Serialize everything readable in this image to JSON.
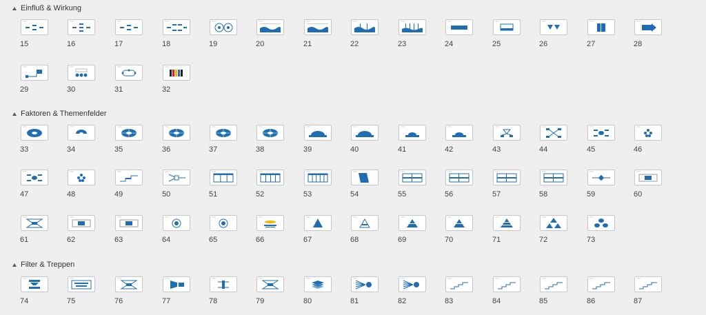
{
  "colors": {
    "accent": "#1f6eb5",
    "background": "#efefef",
    "thumb_border": "#c9c9c9"
  },
  "sections": [
    {
      "title": "Einfluß & Wirkung",
      "rows": [
        [
          {
            "number": "15",
            "icon": "cause-effect-diagram-icon",
            "variant": "flow3"
          },
          {
            "number": "16",
            "icon": "cause-effect-diagram-icon",
            "variant": "flow4"
          },
          {
            "number": "17",
            "icon": "cause-effect-diagram-icon",
            "variant": "flow3"
          },
          {
            "number": "18",
            "icon": "cause-effect-diagram-icon",
            "variant": "flow5"
          },
          {
            "number": "19",
            "icon": "radial-circles-icon",
            "variant": "rings"
          },
          {
            "number": "20",
            "icon": "wave-chart-icon",
            "variant": "wave"
          },
          {
            "number": "21",
            "icon": "wave-chart-icon",
            "variant": "wave2"
          },
          {
            "number": "22",
            "icon": "wave-columns-icon",
            "variant": "wave3"
          },
          {
            "number": "23",
            "icon": "wave-columns-icon",
            "variant": "wave4"
          },
          {
            "number": "24",
            "icon": "bar-icon",
            "variant": "bar"
          },
          {
            "number": "25",
            "icon": "columns-icon",
            "variant": "cols2"
          },
          {
            "number": "26",
            "icon": "funnel-icon",
            "variant": "funnel"
          },
          {
            "number": "27",
            "icon": "block-icon",
            "variant": "block"
          },
          {
            "number": "28",
            "icon": "arrow-icon",
            "variant": "arrow"
          }
        ],
        [
          {
            "number": "29",
            "icon": "connector-icon",
            "variant": "connector"
          },
          {
            "number": "30",
            "icon": "tree-icon",
            "variant": "tree"
          },
          {
            "number": "31",
            "icon": "cycle-icon",
            "variant": "cycle"
          },
          {
            "number": "32",
            "icon": "stripes-icon",
            "variant": "stripes"
          }
        ]
      ]
    },
    {
      "title": "Faktoren & Themenfelder",
      "rows": [
        [
          {
            "number": "33",
            "icon": "donut-icon",
            "variant": "donut"
          },
          {
            "number": "34",
            "icon": "half-donut-icon",
            "variant": "halfdonut"
          },
          {
            "number": "35",
            "icon": "ellipse-segments-icon",
            "variant": "ellipse"
          },
          {
            "number": "36",
            "icon": "ellipse-segments-icon",
            "variant": "ellipse4"
          },
          {
            "number": "37",
            "icon": "ellipse-segments-icon",
            "variant": "ellipse5"
          },
          {
            "number": "38",
            "icon": "ellipse-segments-icon",
            "variant": "ellipse6"
          },
          {
            "number": "39",
            "icon": "dome-icon",
            "variant": "dome"
          },
          {
            "number": "40",
            "icon": "dome-icon",
            "variant": "dome2"
          },
          {
            "number": "41",
            "icon": "dome-icon",
            "variant": "dome3"
          },
          {
            "number": "42",
            "icon": "dome-icon",
            "variant": "dome4"
          },
          {
            "number": "43",
            "icon": "fork-icon",
            "variant": "fork"
          },
          {
            "number": "44",
            "icon": "cross-icon",
            "variant": "cross"
          },
          {
            "number": "45",
            "icon": "mindmap-icon",
            "variant": "mind"
          },
          {
            "number": "46",
            "icon": "cluster-icon",
            "variant": "cluster"
          }
        ],
        [
          {
            "number": "47",
            "icon": "mindmap-icon",
            "variant": "mind2"
          },
          {
            "number": "48",
            "icon": "cluster-icon",
            "variant": "cluster2"
          },
          {
            "number": "49",
            "icon": "steps-icon",
            "variant": "steps"
          },
          {
            "number": "50",
            "icon": "branch-icon",
            "variant": "branch"
          },
          {
            "number": "51",
            "icon": "table-icon",
            "variant": "table3"
          },
          {
            "number": "52",
            "icon": "table-icon",
            "variant": "table4"
          },
          {
            "number": "53",
            "icon": "table-icon",
            "variant": "table5"
          },
          {
            "number": "54",
            "icon": "trapezoid-icon",
            "variant": "trap"
          },
          {
            "number": "55",
            "icon": "grid-icon",
            "variant": "grid"
          },
          {
            "number": "56",
            "icon": "grid-icon",
            "variant": "grid2"
          },
          {
            "number": "57",
            "icon": "grid-icon",
            "variant": "grid3"
          },
          {
            "number": "58",
            "icon": "grid-icon",
            "variant": "grid4"
          },
          {
            "number": "59",
            "icon": "center-node-icon",
            "variant": "center"
          },
          {
            "number": "60",
            "icon": "center-block-icon",
            "variant": "centerblock"
          }
        ],
        [
          {
            "number": "61",
            "icon": "hourglass-icon",
            "variant": "hour"
          },
          {
            "number": "62",
            "icon": "center-block-icon",
            "variant": "centerbox"
          },
          {
            "number": "63",
            "icon": "center-block-icon",
            "variant": "centerbox2"
          },
          {
            "number": "64",
            "icon": "target-icon",
            "variant": "target"
          },
          {
            "number": "65",
            "icon": "target-icon",
            "variant": "target2"
          },
          {
            "number": "66",
            "icon": "layers-icon",
            "variant": "layers"
          },
          {
            "number": "67",
            "icon": "pyramid-icon",
            "variant": "pyr"
          },
          {
            "number": "68",
            "icon": "pyramid-icon",
            "variant": "pyr2"
          },
          {
            "number": "69",
            "icon": "pyramid-icon",
            "variant": "pyr3"
          },
          {
            "number": "70",
            "icon": "pyramid-icon",
            "variant": "pyr4"
          },
          {
            "number": "71",
            "icon": "pyramid-icon",
            "variant": "pyr5"
          },
          {
            "number": "72",
            "icon": "triangles-icon",
            "variant": "tris"
          },
          {
            "number": "73",
            "icon": "ovals-icon",
            "variant": "ovals"
          }
        ]
      ]
    },
    {
      "title": "Filter & Treppen",
      "rows": [
        [
          {
            "number": "74",
            "icon": "filter-icon",
            "variant": "filter"
          },
          {
            "number": "75",
            "icon": "filter-icon",
            "variant": "filter2"
          },
          {
            "number": "76",
            "icon": "hourglass-icon",
            "variant": "hour2"
          },
          {
            "number": "77",
            "icon": "filter-icon",
            "variant": "filter3"
          },
          {
            "number": "78",
            "icon": "filter-icon",
            "variant": "filter4"
          },
          {
            "number": "79",
            "icon": "hourglass-icon",
            "variant": "hour3"
          },
          {
            "number": "80",
            "icon": "stack-icon",
            "variant": "stack"
          },
          {
            "number": "81",
            "icon": "funnel-fan-icon",
            "variant": "fan"
          },
          {
            "number": "82",
            "icon": "funnel-fan-icon",
            "variant": "fan2"
          },
          {
            "number": "83",
            "icon": "stairs-icon",
            "variant": "stairs"
          },
          {
            "number": "84",
            "icon": "stairs-icon",
            "variant": "stairs"
          },
          {
            "number": "85",
            "icon": "stairs-icon",
            "variant": "stairs"
          },
          {
            "number": "86",
            "icon": "stairs-icon",
            "variant": "stairs2"
          },
          {
            "number": "87",
            "icon": "stairs-icon",
            "variant": "stairs3"
          }
        ]
      ]
    }
  ]
}
